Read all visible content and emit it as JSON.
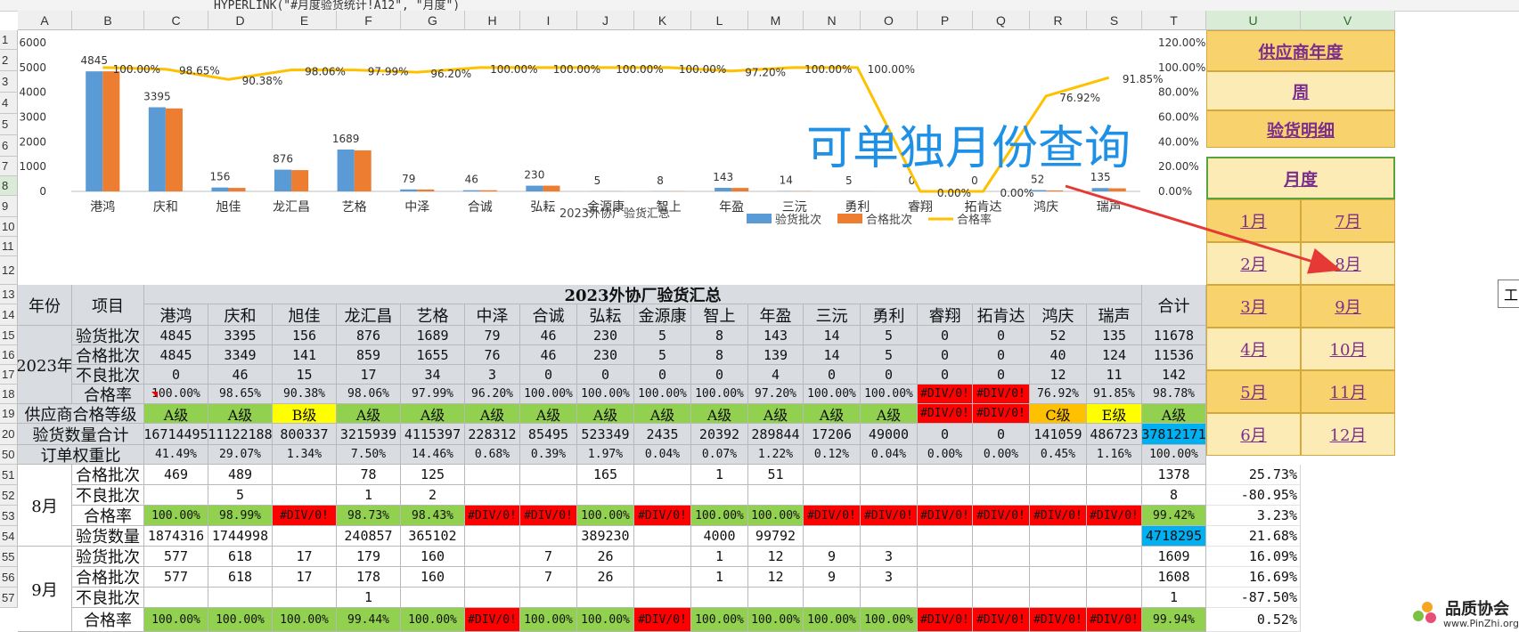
{
  "formula_bar": {
    "text": "HYPERLINK(\"#月度验货统计!A12\", \"月度\")"
  },
  "columns": [
    "A",
    "B",
    "C",
    "D",
    "E",
    "F",
    "G",
    "H",
    "I",
    "J",
    "K",
    "L",
    "M",
    "N",
    "O",
    "P",
    "Q",
    "R",
    "S",
    "T",
    "U",
    "V"
  ],
  "rows": [
    "1",
    "2",
    "3",
    "4",
    "5",
    "6",
    "7",
    "8",
    "9",
    "10",
    "11",
    "12",
    "13",
    "14",
    "15",
    "16",
    "17",
    "18",
    "19",
    "20",
    "50",
    "51",
    "52",
    "53",
    "54",
    "55",
    "56",
    "57"
  ],
  "overlay_text": "可单独月份查询",
  "chart_data": {
    "type": "bar",
    "title": "2023外协厂验货汇总",
    "categories": [
      "港鸿",
      "庆和",
      "旭佳",
      "龙汇昌",
      "艺格",
      "中泽",
      "合诚",
      "弘耘",
      "金源康",
      "智上",
      "年盈",
      "三沅",
      "勇利",
      "睿翔",
      "拓肯达",
      "鸿庆",
      "瑞声"
    ],
    "series": [
      {
        "name": "验货批次",
        "type": "bar",
        "color": "#5b9bd5",
        "values": [
          4845,
          3395,
          156,
          876,
          1689,
          79,
          46,
          230,
          5,
          8,
          143,
          14,
          5,
          0,
          0,
          52,
          135
        ]
      },
      {
        "name": "合格批次",
        "type": "bar",
        "color": "#ed7d31",
        "values": [
          4845,
          3349,
          141,
          859,
          1655,
          76,
          46,
          230,
          5,
          8,
          139,
          14,
          5,
          0,
          0,
          40,
          124
        ]
      },
      {
        "name": "合格率",
        "type": "line",
        "color": "#ffc000",
        "axis": "right",
        "values": [
          100.0,
          98.65,
          90.38,
          98.06,
          97.99,
          96.2,
          100.0,
          100.0,
          100.0,
          100.0,
          97.2,
          100.0,
          100.0,
          0.0,
          0.0,
          76.92,
          91.85
        ]
      }
    ],
    "bar_labels": [
      "4845",
      "3395",
      "156",
      "876",
      "1689",
      "79",
      "46",
      "230",
      "5",
      "8",
      "143",
      "14",
      "5",
      "0",
      "0",
      "52",
      "135"
    ],
    "line_labels": [
      "100.00%",
      "98.65%",
      "90.38%",
      "98.06%",
      "97.99%",
      "96.20%",
      "100.00%",
      "100.00%",
      "100.00%",
      "100.00%",
      "97.20%",
      "100.00%",
      "100.00%",
      "0.00%",
      "0.00%",
      "76.92%",
      "91.85%"
    ],
    "yticks_left": [
      "6000",
      "5000",
      "4000",
      "3000",
      "2000",
      "1000",
      "0"
    ],
    "yticks_right": [
      "120.00%",
      "100.00%",
      "80.00%",
      "60.00%",
      "40.00%",
      "20.00%",
      "0.00%"
    ],
    "ylim_left": [
      0,
      6000
    ],
    "ylim_right": [
      0,
      120
    ],
    "legend_placement": "bottom",
    "grid": false
  },
  "table": {
    "title": "2023外协厂验货汇总",
    "year_label": "年份",
    "item_label": "项目",
    "total_label": "合计",
    "year": "2023年",
    "suppliers": [
      "港鸿",
      "庆和",
      "旭佳",
      "龙汇昌",
      "艺格",
      "中泽",
      "合诚",
      "弘耘",
      "金源康",
      "智上",
      "年盈",
      "三沅",
      "勇利",
      "睿翔",
      "拓肯达",
      "鸿庆",
      "瑞声"
    ],
    "rows": [
      {
        "label": "验货批次",
        "values": [
          "4845",
          "3395",
          "156",
          "876",
          "1689",
          "79",
          "46",
          "230",
          "5",
          "8",
          "143",
          "14",
          "5",
          "0",
          "0",
          "52",
          "135"
        ],
        "total": "11678"
      },
      {
        "label": "合格批次",
        "values": [
          "4845",
          "3349",
          "141",
          "859",
          "1655",
          "76",
          "46",
          "230",
          "5",
          "8",
          "139",
          "14",
          "5",
          "0",
          "0",
          "40",
          "124"
        ],
        "total": "11536"
      },
      {
        "label": "不良批次",
        "values": [
          "0",
          "46",
          "15",
          "17",
          "34",
          "3",
          "0",
          "0",
          "0",
          "0",
          "4",
          "0",
          "0",
          "0",
          "0",
          "12",
          "11"
        ],
        "total": "142"
      },
      {
        "label": "合格率",
        "values": [
          "100.00%",
          "98.65%",
          "90.38%",
          "98.06%",
          "97.99%",
          "96.20%",
          "100.00%",
          "100.00%",
          "100.00%",
          "100.00%",
          "97.20%",
          "100.00%",
          "100.00%",
          "#DIV/0!",
          "#DIV/0!",
          "76.92%",
          "91.85%"
        ],
        "total": "98.78%"
      }
    ],
    "grade_row": {
      "label": "供应商合格等级",
      "values": [
        "A级",
        "A级",
        "B级",
        "A级",
        "A级",
        "A级",
        "A级",
        "A级",
        "A级",
        "A级",
        "A级",
        "A级",
        "A级",
        "#DIV/0!",
        "#DIV/0!",
        "C级",
        "E级"
      ],
      "total": "A级"
    },
    "qty_row": {
      "label": "验货数量合计",
      "values": [
        "16714495",
        "11122188",
        "800337",
        "3215939",
        "4115397",
        "228312",
        "85495",
        "523349",
        "2435",
        "20392",
        "289844",
        "17206",
        "49000",
        "0",
        "0",
        "141059",
        "486723"
      ],
      "total": "37812171"
    },
    "weight_row": {
      "label": "订单权重比",
      "values": [
        "41.49%",
        "29.07%",
        "1.34%",
        "7.50%",
        "14.46%",
        "0.68%",
        "0.39%",
        "1.97%",
        "0.04%",
        "0.07%",
        "1.22%",
        "0.12%",
        "0.04%",
        "0.00%",
        "0.00%",
        "0.45%",
        "1.16%"
      ],
      "total": "100.00%"
    }
  },
  "months": [
    {
      "month": "8月",
      "rows": [
        {
          "label": "合格批次",
          "values": [
            "469",
            "489",
            "",
            "78",
            "125",
            "",
            "",
            "165",
            "",
            "1",
            "51",
            "",
            "",
            "",
            "",
            "",
            ""
          ],
          "total": "1378",
          "right": "25.73%"
        },
        {
          "label": "不良批次",
          "values": [
            "",
            "5",
            "",
            "1",
            "2",
            "",
            "",
            "",
            "",
            "",
            "",
            "",
            "",
            "",
            "",
            "",
            ""
          ],
          "total": "8",
          "right": "-80.95%"
        },
        {
          "label": "合格率",
          "values": [
            "100.00%",
            "98.99%",
            "#DIV/0!",
            "98.73%",
            "98.43%",
            "#DIV/0!",
            "#DIV/0!",
            "100.00%",
            "#DIV/0!",
            "100.00%",
            "100.00%",
            "#DIV/0!",
            "#DIV/0!",
            "#DIV/0!",
            "#DIV/0!",
            "#DIV/0!",
            "#DIV/0!"
          ],
          "total": "99.42%",
          "right": "3.23%"
        },
        {
          "label": "验货数量",
          "values": [
            "1874316",
            "1744998",
            "",
            "240857",
            "365102",
            "",
            "",
            "389230",
            "",
            "4000",
            "99792",
            "",
            "",
            "",
            "",
            "",
            ""
          ],
          "total": "4718295",
          "right": "21.68%"
        }
      ]
    },
    {
      "month": "9月",
      "rows": [
        {
          "label": "验货批次",
          "values": [
            "577",
            "618",
            "17",
            "179",
            "160",
            "",
            "7",
            "26",
            "",
            "1",
            "12",
            "9",
            "3",
            "",
            "",
            "",
            ""
          ],
          "total": "1609",
          "right": "16.09%"
        },
        {
          "label": "合格批次",
          "values": [
            "577",
            "618",
            "17",
            "178",
            "160",
            "",
            "7",
            "26",
            "",
            "1",
            "12",
            "9",
            "3",
            "",
            "",
            "",
            ""
          ],
          "total": "1608",
          "right": "16.69%"
        },
        {
          "label": "不良批次",
          "values": [
            "",
            "",
            "",
            "1",
            "",
            "",
            "",
            "",
            "",
            "",
            "",
            "",
            "",
            "",
            "",
            "",
            ""
          ],
          "total": "1",
          "right": "-87.50%"
        },
        {
          "label": "合格率",
          "values": [
            "100.00%",
            "100.00%",
            "100.00%",
            "99.44%",
            "100.00%",
            "#DIV/0!",
            "100.00%",
            "100.00%",
            "#DIV/0!",
            "100.00%",
            "100.00%",
            "100.00%",
            "100.00%",
            "#DIV/0!",
            "#DIV/0!",
            "#DIV/0!",
            "#DIV/0!"
          ],
          "total": "99.94%",
          "right": "0.52%"
        }
      ]
    }
  ],
  "nav": {
    "supplier_year": "供应商年度",
    "week": "周",
    "detail": "验货明细",
    "month": "月度",
    "months_left": [
      "1月",
      "2月",
      "3月",
      "4月",
      "5月",
      "6月"
    ],
    "months_right": [
      "7月",
      "8月",
      "9月",
      "10月",
      "11月",
      "12月"
    ]
  },
  "tooltip_char": "工",
  "logo": {
    "name": "品质协会",
    "url": "www.PinZhi.org"
  },
  "colors": {
    "bar1": "#5b9bd5",
    "bar2": "#ed7d31",
    "line": "#ffc000",
    "pass": "#92d050",
    "fail": "#ff0000",
    "b_grade": "#ffff00",
    "c_grade": "#ffc000",
    "total": "#00b0f0",
    "nav_dark": "#f8d26c",
    "nav_light": "#fdebb5"
  }
}
